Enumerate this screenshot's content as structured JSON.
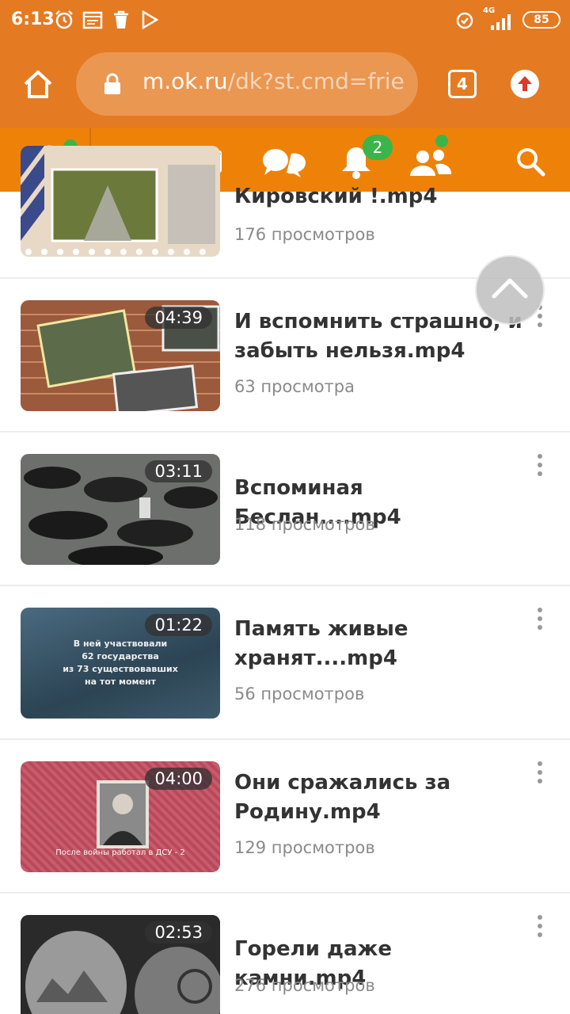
{
  "status_bar": {
    "time": "6:13",
    "network": "4G",
    "battery": "85"
  },
  "browser": {
    "url_host": "m.ok.ru",
    "url_path": "/dk?st.cmd=frie",
    "tab_count": "4"
  },
  "toolbar": {
    "notifications_badge": "2"
  },
  "videos": [
    {
      "title": "Кировский !.mp4",
      "views": "176 просмотров",
      "duration": ""
    },
    {
      "title": "И вспомнить страшно, и забыть нельзя.mp4",
      "views": "63 просмотра",
      "duration": "04:39"
    },
    {
      "title": "Вспоминая Беслан....mp4",
      "views": "118 просмотров",
      "duration": "03:11"
    },
    {
      "title": "Память живые хранят....mp4",
      "views": "56 просмотров",
      "duration": "01:22"
    },
    {
      "title": "Они сражались за Родину.mp4",
      "views": "129 просмотров",
      "duration": "04:00"
    },
    {
      "title": "Горели даже камни.mp4",
      "views": "276 просмотров",
      "duration": "02:53"
    }
  ],
  "thumb_captions": {
    "v3": [
      "В ней участвовали",
      "62 государства",
      "из 73 существовавших",
      "на тот момент"
    ],
    "v4": "После войны работал в ДСУ - 2"
  },
  "colors": {
    "status_bar": "#e47a22",
    "toolbar": "#ee8208",
    "badge": "#3ab54a"
  }
}
